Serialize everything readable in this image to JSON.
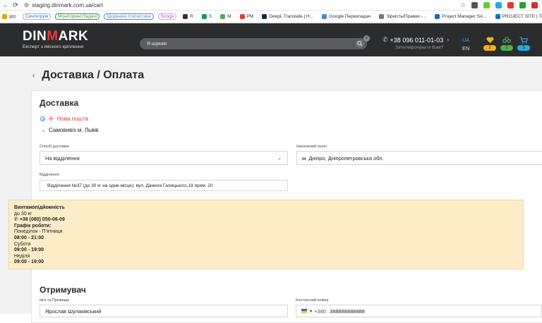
{
  "browser": {
    "url": "staging.dinmark.com.ua/cart"
  },
  "bookmarks": [
    {
      "label": "урс",
      "color": "#f0a000"
    },
    {
      "label": "Синтегрум",
      "color": "#3c6cd9",
      "pill": true,
      "border": "#8ab4f8"
    },
    {
      "label": "Моніторинг/Задачі",
      "color": "#2e9d3a",
      "pill": true,
      "border": "#2e9d3a"
    },
    {
      "label": "Щоденна статистика",
      "color": "#3a8be0",
      "pill": true,
      "border": "#3a8be0"
    },
    {
      "label": "Songs",
      "color": "#a24bd6",
      "pill": true,
      "border": "#c9a5e4"
    },
    {
      "label": "R",
      "color": "#333"
    },
    {
      "label": "S",
      "color": "#0f9d58"
    },
    {
      "label": "M",
      "color": "#4caf50"
    },
    {
      "label": "PM",
      "color": "#e53935"
    },
    {
      "label": "DeepL Translate | Н...",
      "color": "#0f2b46"
    },
    {
      "label": "Google Перекладач",
      "color": "#4285f4"
    },
    {
      "label": "Зірність/Правки -...",
      "color": "#777"
    },
    {
      "label": "Project Manager SA...",
      "color": "#1565c0"
    },
    {
      "label": "PROJECT SITE | Trello",
      "color": "#0079bf"
    }
  ],
  "header": {
    "logo_main_a": "DIN",
    "logo_main_m": "M",
    "logo_main_b": "ARK",
    "logo_sub": "Експерт з якісного кріплення",
    "search_placeholder": "Я шукаю",
    "phone": "+38 096 011-01-03",
    "callback": "Зателефонувати Вам?",
    "lang_ua": "UA",
    "lang_en": "EN",
    "badges": [
      {
        "icon": "heart-icon",
        "count": "2",
        "color": "#f2b01e",
        "bg": "#f2b01e"
      },
      {
        "icon": "compare-icon",
        "count": "2",
        "color": "#4caf50",
        "bg": "#4caf50"
      },
      {
        "icon": "cart-icon",
        "count": "5",
        "color": "#29a9e0",
        "bg": "#29a9e0"
      }
    ]
  },
  "page": {
    "title": "Доставка / Оплата"
  },
  "delivery": {
    "section_title": "Доставка",
    "option_nova": "Нова пошта",
    "option_pickup": "Самовивіз м. Львів",
    "method_label": "Спосіб доставки",
    "method_value": "На відділення",
    "city_label": "Населений пункт",
    "city_value": "м. Дніпро, Дніпропетровська обл.",
    "branch_label": "Відділення",
    "branch_value": "Відділення №37 (до 30 кг на одне місце): вул. Данила Галицького,19 прим. 20"
  },
  "info": {
    "capacity_label": "Вантажопідйомність",
    "capacity_value": "до 30 кг",
    "phone": "+38 (080) 050-06-09",
    "schedule_label": "Графік роботи:",
    "weekdays": "Понеділок - П'ятниця",
    "weekdays_hours": "08:00 - 21:00",
    "saturday": "Субота",
    "saturday_hours": "09:00 - 19:00",
    "sunday": "Неділя",
    "sunday_hours": "09:00 - 19:00"
  },
  "recipient": {
    "section_title": "Отримувач",
    "name_label": "Ім'я та Прізвище",
    "name_value": "Ярослав Шулаківський",
    "phone_label": "Контактний номер",
    "phone_code": "+380",
    "phone_value": "388888888888"
  }
}
